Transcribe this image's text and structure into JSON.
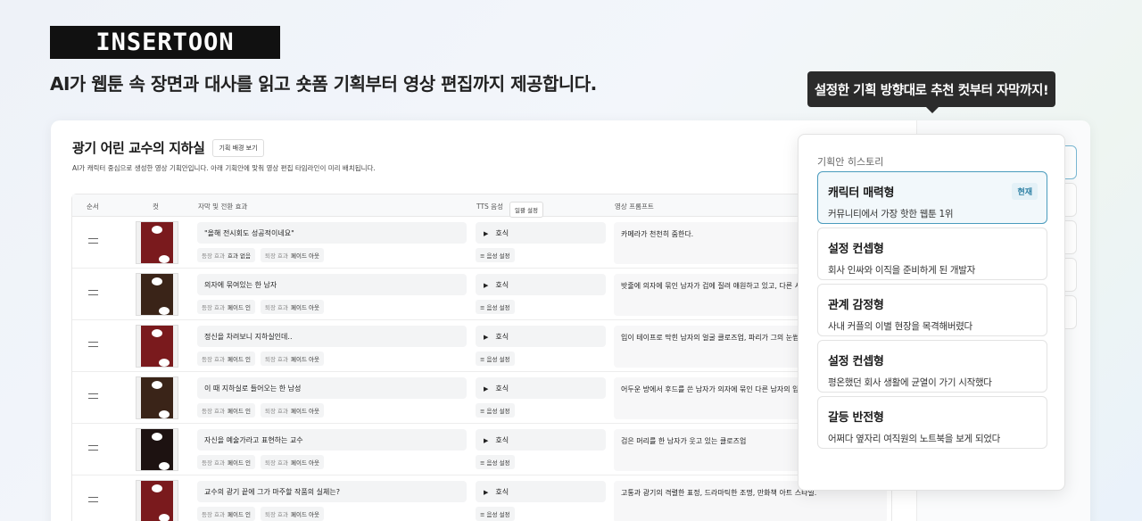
{
  "brand": {
    "logo": "INSERTOON"
  },
  "tagline": "AI가 웹툰 속 장면과 대사를 읽고 숏폼 기획부터 영상 편집까지 제공합니다.",
  "tooltip": "설정한 기획 방향대로 추천 컷부터 자막까지!",
  "project": {
    "title": "광기 어린 교수의 지하실",
    "bg_button": "기획 배경 보기",
    "description": "AI가 캐릭터 중심으로 생성한 영상 기획안입니다. 아래 기획안에 맞춰 영상 편집 타임라인이 미리 배치됩니다."
  },
  "table": {
    "headers": {
      "order": "순서",
      "cut": "컷",
      "subtitle": "자막 및 전환 효과",
      "tts": "TTS 음성",
      "bulk": "일괄 설정",
      "prompt": "영상 프롬프트"
    },
    "labels": {
      "enter": "등장 효과",
      "exit": "퇴장 효과",
      "voice_setting": "음성 설정"
    },
    "rows": [
      {
        "subtitle": "\"올해 전시회도 성공적이네요\"",
        "enter": "효과 없음",
        "exit": "페이드 아웃",
        "voice": "호식",
        "prompt": "카메라가 천천히 줌한다.",
        "thumb": "red"
      },
      {
        "subtitle": "의자에 묶여있는 한 남자",
        "enter": "페이드 인",
        "exit": "페이드 아웃",
        "voice": "호식",
        "prompt": "밧줄에 의자에 묶인 남자가 겁에 질려 얘원하고 있고, 다른 사람",
        "thumb": "brown"
      },
      {
        "subtitle": "정신을 차려보니 지하실인데..",
        "enter": "페이드 인",
        "exit": "페이드 아웃",
        "voice": "호식",
        "prompt": "입이 테이프로 막힌 남자의 얼굴 클로즈업, 파리가 그의 눈썹 사",
        "thumb": "red"
      },
      {
        "subtitle": "이 때 지하실로 들어오는 한 남성",
        "enter": "페이드 인",
        "exit": "페이드 아웃",
        "voice": "호식",
        "prompt": "어두운 방에서 후드를 쓴 남자가 의자에 묶인 다른 남자의 입을",
        "thumb": "brown"
      },
      {
        "subtitle": "자신을 예술가라고 표현하는 교수",
        "enter": "페이드 인",
        "exit": "페이드 아웃",
        "voice": "호식",
        "prompt": "검은 머리를 한 남자가 웃고 있는 클로즈업",
        "thumb": "dark"
      },
      {
        "subtitle": "교수의 광기 끝에 그가 마주할 작품의 실체는?",
        "enter": "페이드 인",
        "exit": "페이드 아웃",
        "voice": "호식",
        "prompt": "고통과 광기의 격렬한 표정, 드라마틱한 조명, 만화책 아트 스타일.",
        "thumb": "red"
      }
    ]
  },
  "history": {
    "title": "기획안 히스토리",
    "current_badge": "현재",
    "items": [
      {
        "name": "캐릭터 매력형",
        "sub": "커뮤니티에서 가장 핫한 웹툰 1위",
        "current": true
      },
      {
        "name": "설정 컨셉형",
        "sub": "회사 인싸와 이직을 준비하게 된 개발자",
        "current": false
      },
      {
        "name": "관계 감정형",
        "sub": "사내 커플의 이별 현장을 목격해버렸다",
        "current": false
      },
      {
        "name": "설정 컨셉형",
        "sub": "평온했던 회사 생활에 균열이 가기 시작했다",
        "current": false
      },
      {
        "name": "갈등 반전형",
        "sub": "어쩌다 옆자리 여직원의 노트북을 보게 되었다",
        "current": false
      }
    ]
  }
}
